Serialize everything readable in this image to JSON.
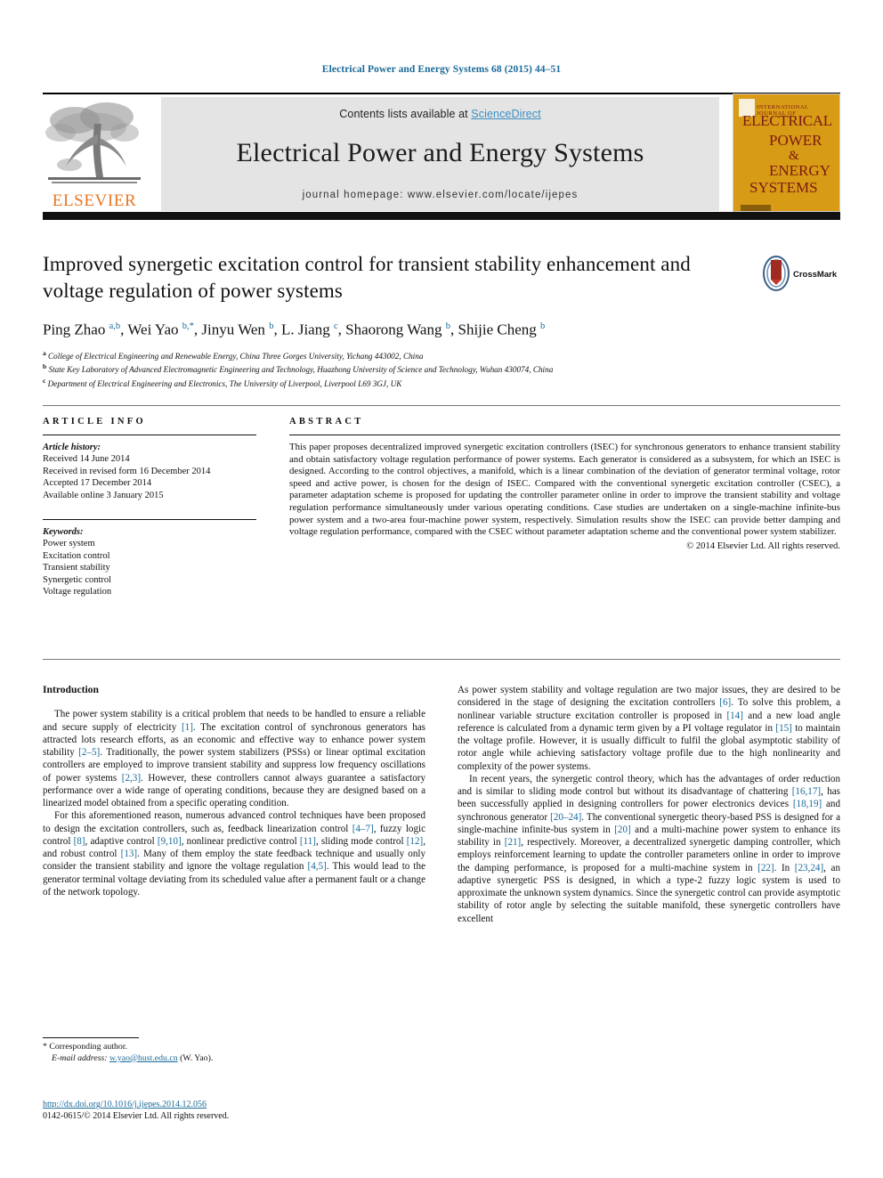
{
  "running_head": "Electrical Power and Energy Systems 68 (2015) 44–51",
  "masthead": {
    "contents_prefix": "Contents lists available at ",
    "sciencedirect": "ScienceDirect",
    "journal_title": "Electrical Power and Energy Systems",
    "homepage": "journal homepage: www.elsevier.com/locate/ijepes",
    "publisher_logo_text": "ELSEVIER",
    "cover": {
      "kicker": "INTERNATIONAL JOURNAL OF",
      "line1": "ELECTRICAL",
      "line2": "POWER",
      "line3": "&",
      "line4": "ENERGY",
      "line5": "SYSTEMS",
      "background_color": "#D79B16",
      "text_color": "#7d1a14"
    }
  },
  "article": {
    "title": "Improved synergetic excitation control for transient stability enhancement and voltage regulation of power systems",
    "authors_html": "Ping Zhao <sup>a,b</sup>, Wei Yao <sup>b,*</sup>, Jinyu Wen <sup>b</sup>, L. Jiang <sup>c</sup>, Shaorong Wang <sup>b</sup>, Shijie Cheng <sup>b</sup>",
    "affiliations": [
      "a College of Electrical Engineering and Renewable Energy, China Three Gorges University, Yichang 443002, China",
      "b State Key Laboratory of Advanced Electromagnetic Engineering and Technology, Huazhong University of Science and Technology, Wuhan 430074, China",
      "c Department of Electrical Engineering and Electronics, The University of Liverpool, Liverpool L69 3GJ, UK"
    ],
    "affiliations_html": "<sup>a</sup> College of Electrical Engineering and Renewable Energy, China Three Gorges University, Yichang 443002, China<br><sup>b</sup> State Key Laboratory of Advanced Electromagnetic Engineering and Technology, Huazhong University of Science and Technology, Wuhan 430074, China<br><sup>c</sup> Department of Electrical Engineering and Electronics, The University of Liverpool, Liverpool L69 3GJ, UK",
    "crossmark_label": "CrossMark"
  },
  "article_info": {
    "heading": "ARTICLE INFO",
    "history_label": "Article history:",
    "history": [
      "Received 14 June 2014",
      "Received in revised form 16 December 2014",
      "Accepted 17 December 2014",
      "Available online 3 January 2015"
    ],
    "keywords_label": "Keywords:",
    "keywords": [
      "Power system",
      "Excitation control",
      "Transient stability",
      "Synergetic control",
      "Voltage regulation"
    ]
  },
  "abstract": {
    "heading": "ABSTRACT",
    "text": "This paper proposes decentralized improved synergetic excitation controllers (ISEC) for synchronous generators to enhance transient stability and obtain satisfactory voltage regulation performance of power systems. Each generator is considered as a subsystem, for which an ISEC is designed. According to the control objectives, a manifold, which is a linear combination of the deviation of generator terminal voltage, rotor speed and active power, is chosen for the design of ISEC. Compared with the conventional synergetic excitation controller (CSEC), a parameter adaptation scheme is proposed for updating the controller parameter online in order to improve the transient stability and voltage regulation performance simultaneously under various operating conditions. Case studies are undertaken on a single-machine infinite-bus power system and a two-area four-machine power system, respectively. Simulation results show the ISEC can provide better damping and voltage regulation performance, compared with the CSEC without parameter adaptation scheme and the conventional power system stabilizer.",
    "copyright": "© 2014 Elsevier Ltd. All rights reserved."
  },
  "body": {
    "section_heading": "Introduction",
    "left_col_html": "<p>The power system stability is a critical problem that needs to be handled to ensure a reliable and secure supply of electricity <span class=\"ref\">[1]</span>. The excitation control of synchronous generators has attracted lots research efforts, as an economic and effective way to enhance power system stability <span class=\"ref\">[2–5]</span>. Traditionally, the power system stabilizers (PSSs) or linear optimal excitation controllers are employed to improve transient stability and suppress low frequency oscillations of power systems <span class=\"ref\">[2,3]</span>. However, these controllers cannot always guarantee a satisfactory performance over a wide range of operating conditions, because they are designed based on a linearized model obtained from a specific operating condition.</p><p>For this aforementioned reason, numerous advanced control techniques have been proposed to design the excitation controllers, such as, feedback linearization control <span class=\"ref\">[4–7]</span>, fuzzy logic control <span class=\"ref\">[8]</span>, adaptive control <span class=\"ref\">[9,10]</span>, nonlinear predictive control <span class=\"ref\">[11]</span>, sliding mode control <span class=\"ref\">[12]</span>, and robust control <span class=\"ref\">[13]</span>. Many of them employ the state feedback technique and usually only consider the transient stability and ignore the voltage regulation <span class=\"ref\">[4,5]</span>. This would lead to the generator terminal voltage deviating from its scheduled value after a permanent fault or a change of the network topology.</p>",
    "right_col_html": "<p style=\"text-indent:0\">As power system stability and voltage regulation are two major issues, they are desired to be considered in the stage of designing the excitation controllers <span class=\"ref\">[6]</span>. To solve this problem, a nonlinear variable structure excitation controller is proposed in <span class=\"ref\">[14]</span> and a new load angle reference is calculated from a dynamic term given by a PI voltage regulator in <span class=\"ref\">[15]</span> to maintain the voltage profile. However, it is usually difficult to fulfil the global asymptotic stability of rotor angle while achieving satisfactory voltage profile due to the high nonlinearity and complexity of the power systems.</p><p>In recent years, the synergetic control theory, which has the advantages of order reduction and is similar to sliding mode control but without its disadvantage of chattering <span class=\"ref\">[16,17]</span>, has been successfully applied in designing controllers for power electronics devices <span class=\"ref\">[18,19]</span> and synchronous generator <span class=\"ref\">[20–24]</span>. The conventional synergetic theory-based PSS is designed for a single-machine infinite-bus system in <span class=\"ref\">[20]</span> and a multi-machine power system to enhance its stability in <span class=\"ref\">[21]</span>, respectively. Moreover, a decentralized synergetic damping controller, which employs reinforcement learning to update the controller parameters online in order to improve the damping performance, is proposed for a multi-machine system in <span class=\"ref\">[22]</span>. In <span class=\"ref\">[23,24]</span>, an adaptive synergetic PSS is designed, in which a type-2 fuzzy logic system is used to approximate the unknown system dynamics. Since the synergetic control can provide asymptotic stability of rotor angle by selecting the suitable manifold, these synergetic controllers have excellent</p>"
  },
  "footnote": {
    "corresponding_marker": "*",
    "corresponding_text": "Corresponding author.",
    "email_label": "E-mail address:",
    "email": "w.yao@hust.edu.cn",
    "email_owner": "(W. Yao)."
  },
  "footer": {
    "doi": "http://dx.doi.org/10.1016/j.ijepes.2014.12.056",
    "issn_line": "0142-0615/© 2014 Elsevier Ltd. All rights reserved."
  },
  "colors": {
    "link_blue": "#1a6a9a",
    "sciencedirect_blue": "#3a8fc4",
    "elsevier_orange": "#E87722",
    "masthead_grey": "#e4e4e4"
  }
}
